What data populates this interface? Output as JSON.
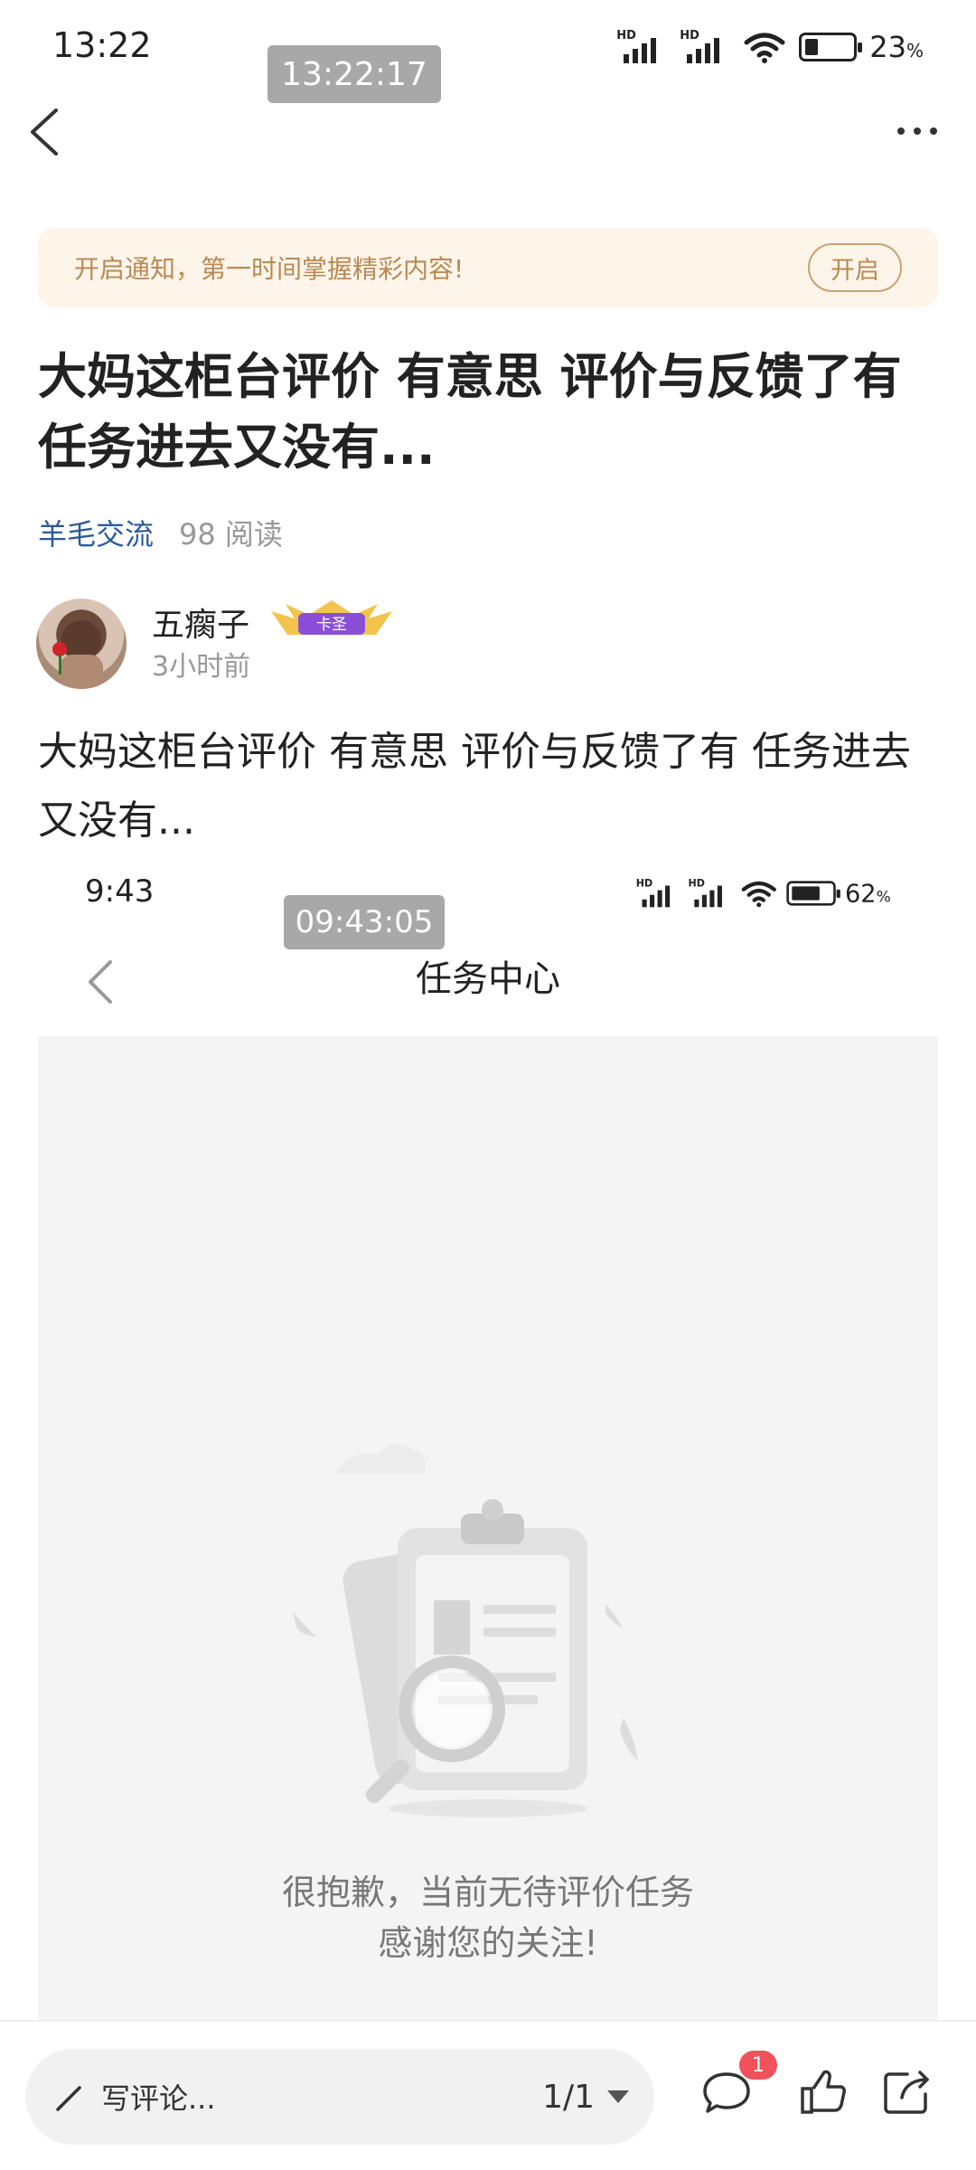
{
  "status_bar": {
    "time": "13:22",
    "hd1": "HD",
    "hd2": "HD",
    "battery_pct": "23",
    "battery_unit": "%"
  },
  "timestamp_badge": "13:22:17",
  "notice": {
    "text": "开启通知，第一时间掌握精彩内容!",
    "button": "开启"
  },
  "article": {
    "title": "大妈这柜台评价 有意思 评价与反馈了有任务进去又没有...",
    "category": "羊毛交流",
    "reads": "98 阅读",
    "body": "大妈这柜台评价 有意思 评价与反馈了有 任务进去又没有..."
  },
  "author": {
    "name": "五瘸子",
    "badge": "卡圣",
    "time": "3小时前"
  },
  "embedded_screenshot": {
    "time": "9:43",
    "hd1": "HD",
    "hd2": "HD",
    "battery_pct": "62",
    "battery_unit": "%",
    "timestamp_badge": "09:43:05",
    "title": "任务中心",
    "empty_line1": "很抱歉，当前无待评价任务",
    "empty_line2": "感谢您的关注!"
  },
  "bottom_bar": {
    "comment_placeholder": "写评论...",
    "page_indicator": "1/1",
    "comment_count": "1"
  },
  "colors": {
    "accent_category": "#2c5a99",
    "notice_bg": "#fdf4ea",
    "notice_text": "#b98a52",
    "badge_red": "#f0515b"
  },
  "icons": {
    "back": "chevron-left-icon",
    "more": "more-dots-icon",
    "wifi": "wifi-icon",
    "battery": "battery-icon",
    "pencil": "pencil-icon",
    "comment": "comment-bubble-icon",
    "like": "thumbs-up-icon",
    "share": "share-icon"
  }
}
